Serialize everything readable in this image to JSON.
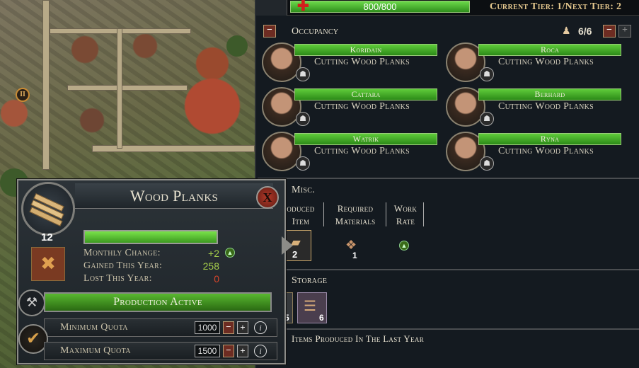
{
  "top": {
    "health": "800/800",
    "tier": "Current Tier: 1/Next Tier: 2"
  },
  "occupancy": {
    "title": "Occupancy",
    "count": "6/6",
    "workers": [
      {
        "name": "Koridain",
        "task": "Cutting Wood Planks"
      },
      {
        "name": "Roca",
        "task": "Cutting Wood Planks"
      },
      {
        "name": "Cattara",
        "task": "Cutting Wood Planks"
      },
      {
        "name": "Berhard",
        "task": "Cutting Wood Planks"
      },
      {
        "name": "Watrik",
        "task": "Cutting Wood Planks"
      },
      {
        "name": "Ryna",
        "task": "Cutting Wood Planks"
      }
    ]
  },
  "misc": {
    "title": "Misc.",
    "columns": [
      "oduced Item",
      "Required Materials",
      "Work Rate"
    ],
    "produced_count": "2",
    "required_count": "1"
  },
  "storage": {
    "title": "Storage",
    "slot1_count": "5",
    "slot2_count": "6"
  },
  "items_produced": {
    "title": "Items Produced In The Last Year"
  },
  "popup": {
    "title": "Wood Planks",
    "close": "X",
    "count": "12",
    "progress": 1.0,
    "monthly_change_label": "Monthly Change:",
    "monthly_change_value": "+2",
    "gained_label": "Gained This Year:",
    "gained_value": "258",
    "lost_label": "Lost This Year:",
    "lost_value": "0",
    "production": "Production Active",
    "min_quota_label": "Minimum Quota",
    "min_quota_value": "1000",
    "max_quota_label": "Maximum Quota",
    "max_quota_value": "1500"
  },
  "colors": {
    "green": "#5fcc3a",
    "red": "#d21d1d",
    "gold": "#e6c98f"
  },
  "icons": [
    "health-cross-icon",
    "worker-icon",
    "plank-icon",
    "hammer-icon",
    "checkmark-icon",
    "info-icon",
    "wood-pile-icon"
  ]
}
